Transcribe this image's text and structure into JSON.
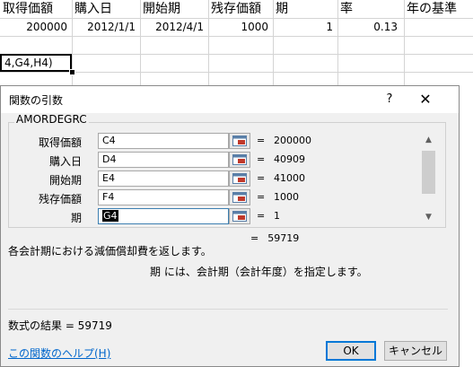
{
  "sheet": {
    "headers": [
      "取得価額",
      "購入日",
      "開始期",
      "残存価額",
      "期",
      "率",
      "年の基準"
    ],
    "row": [
      "200000",
      "2012/1/1",
      "2012/4/1",
      "1000",
      "1",
      "0.13",
      ""
    ],
    "active_cell_text": "4,G4,H4)"
  },
  "dialog": {
    "title": "関数の引数",
    "help_glyph": "?",
    "close_glyph": "✕",
    "function_name": "AMORDEGRC",
    "args": [
      {
        "label": "取得価額",
        "input": "C4",
        "value": "200000"
      },
      {
        "label": "購入日",
        "input": "D4",
        "value": "40909"
      },
      {
        "label": "開始期",
        "input": "E4",
        "value": "41000"
      },
      {
        "label": "残存価額",
        "input": "F4",
        "value": "1000"
      },
      {
        "label": "期",
        "input": "G4",
        "value": "1"
      }
    ],
    "equals": "=",
    "inline_result": "59719",
    "description": "各会計期における減価償却費を返します。",
    "arg_description": "期  には、会計期（会計年度）を指定します。",
    "formula_result": "数式の結果 =  59719",
    "help_link": "この関数のヘルプ(H)",
    "ok_label": "OK",
    "cancel_label": "キャンセル",
    "scroll_up_glyph": "▲",
    "scroll_down_glyph": "▼"
  },
  "colors": {
    "link": "#0066cc",
    "ok_border": "#0078d7",
    "dialog_bg": "#f0f0f0"
  }
}
